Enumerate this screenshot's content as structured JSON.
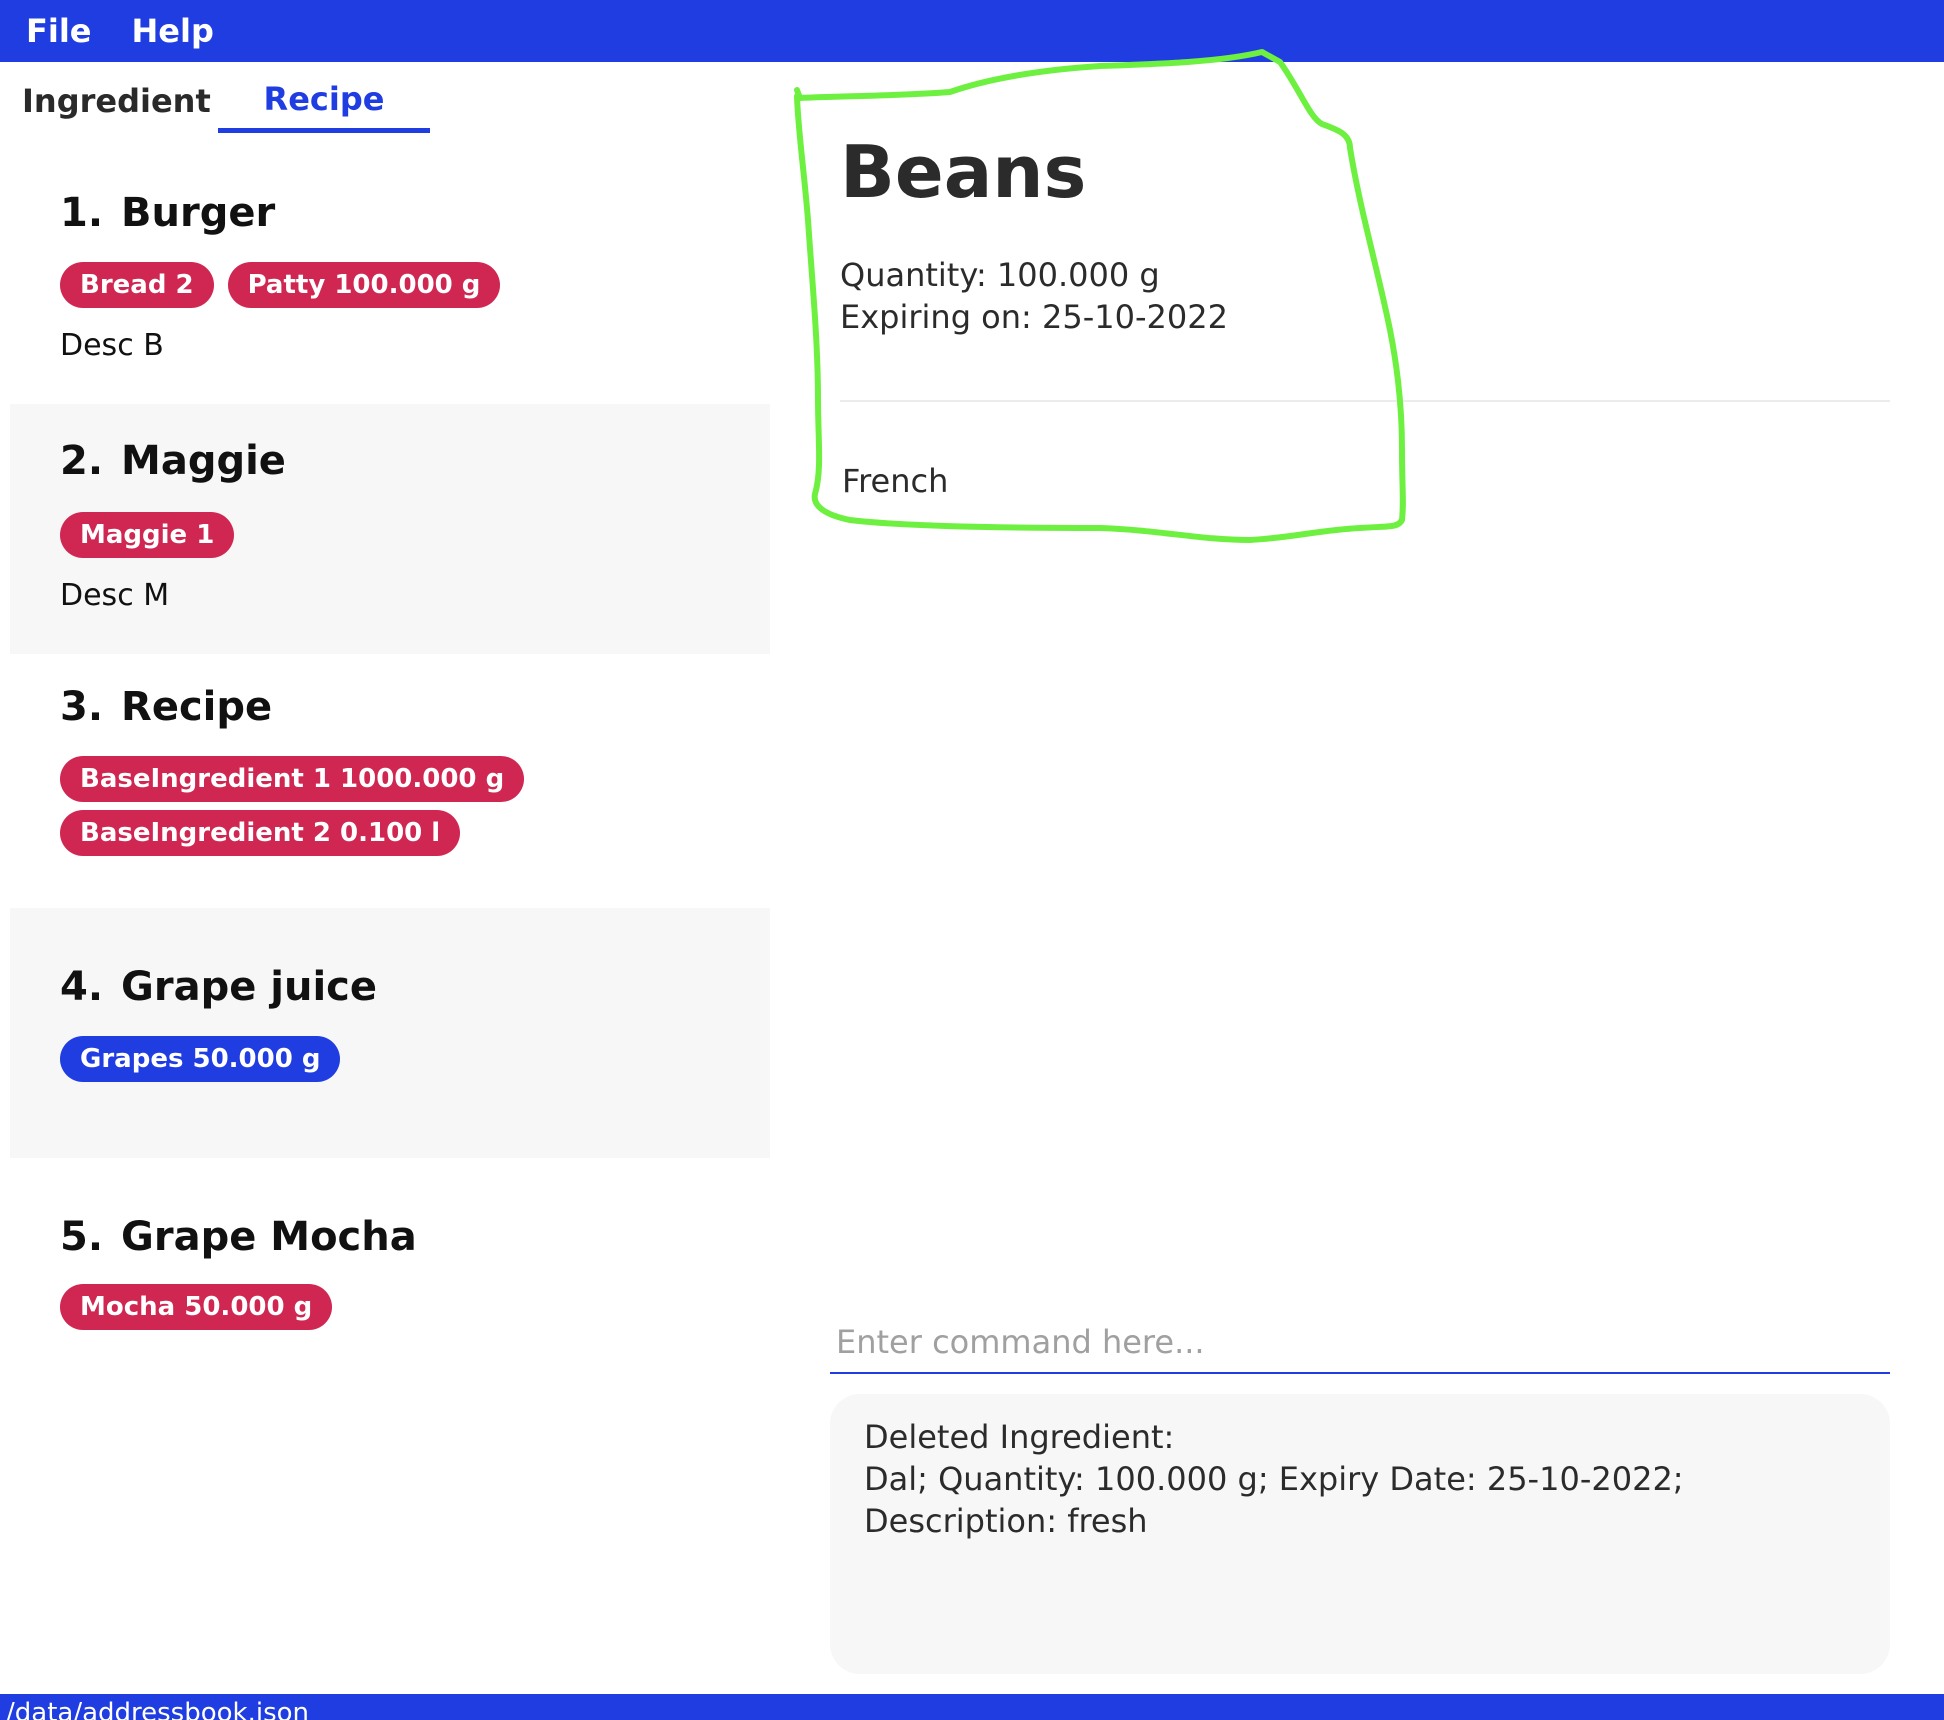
{
  "menu": {
    "file": "File",
    "help": "Help"
  },
  "tabs": {
    "ingredient": "Ingredient",
    "recipe": "Recipe"
  },
  "recipes": [
    {
      "index": "1.",
      "name": "Burger",
      "tags": [
        "Bread 2",
        "Patty 100.000 g"
      ],
      "desc": "Desc B"
    },
    {
      "index": "2.",
      "name": "Maggie",
      "tags": [
        "Maggie 1"
      ],
      "desc": "Desc M"
    },
    {
      "index": "3.",
      "name": "Recipe",
      "tags": [
        "BaseIngredient 1 1000.000 g",
        "BaseIngredient 2 0.100 l"
      ],
      "desc": ""
    },
    {
      "index": "4.",
      "name": "Grape juice",
      "tags": [
        "Grapes 50.000 g"
      ],
      "desc": ""
    },
    {
      "index": "5.",
      "name": "Grape Mocha",
      "tags": [
        "Mocha 50.000 g"
      ],
      "desc": ""
    }
  ],
  "detail": {
    "title": "Beans",
    "quantity": "Quantity: 100.000 g",
    "expiry": "Expiring on: 25-10-2022",
    "desc": "French"
  },
  "command": {
    "placeholder": "Enter command here..."
  },
  "result": {
    "line1": "Deleted Ingredient:",
    "line2": "Dal; Quantity: 100.000 g; Expiry Date: 25-10-2022; Description: fresh"
  },
  "status": {
    "path": "/data/addressbook.json"
  },
  "colors": {
    "primary": "#1f3de0",
    "tag": "#d02752",
    "annotation": "#6ef040"
  }
}
